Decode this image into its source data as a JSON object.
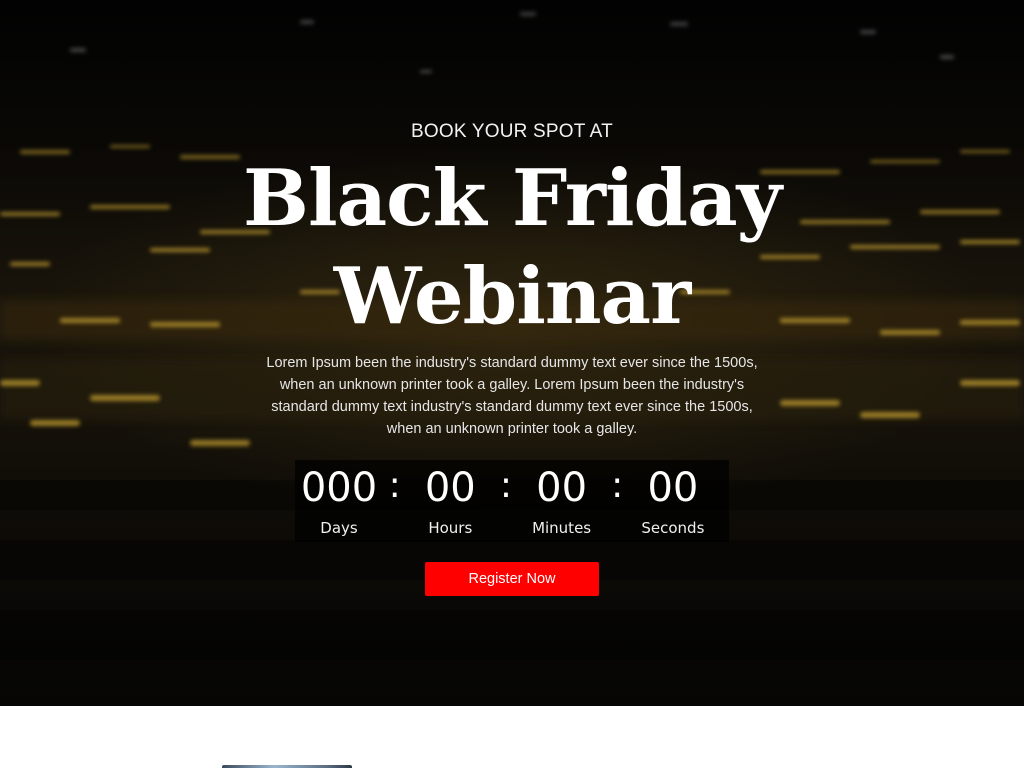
{
  "hero": {
    "kicker": "BOOK YOUR SPOT AT",
    "title_line1": "Black Friday",
    "title_line2": "Webinar",
    "description": "Lorem Ipsum been the industry's standard dummy text ever since the 1500s, when an unknown printer took a galley. Lorem Ipsum been the industry's standard dummy text industry's standard dummy text ever since the 1500s, when an unknown printer took a galley.",
    "background_icon": "dark-auditorium-seats-image",
    "accent_color": "#ff0000"
  },
  "countdown": {
    "separator": ":",
    "units": [
      {
        "value": "000",
        "label": "Days"
      },
      {
        "value": "00",
        "label": "Hours"
      },
      {
        "value": "00",
        "label": "Minutes"
      },
      {
        "value": "00",
        "label": "Seconds"
      }
    ]
  },
  "cta": {
    "register_label": "Register Now"
  },
  "below_section": {
    "image_icon": "webinar-preview-image"
  }
}
